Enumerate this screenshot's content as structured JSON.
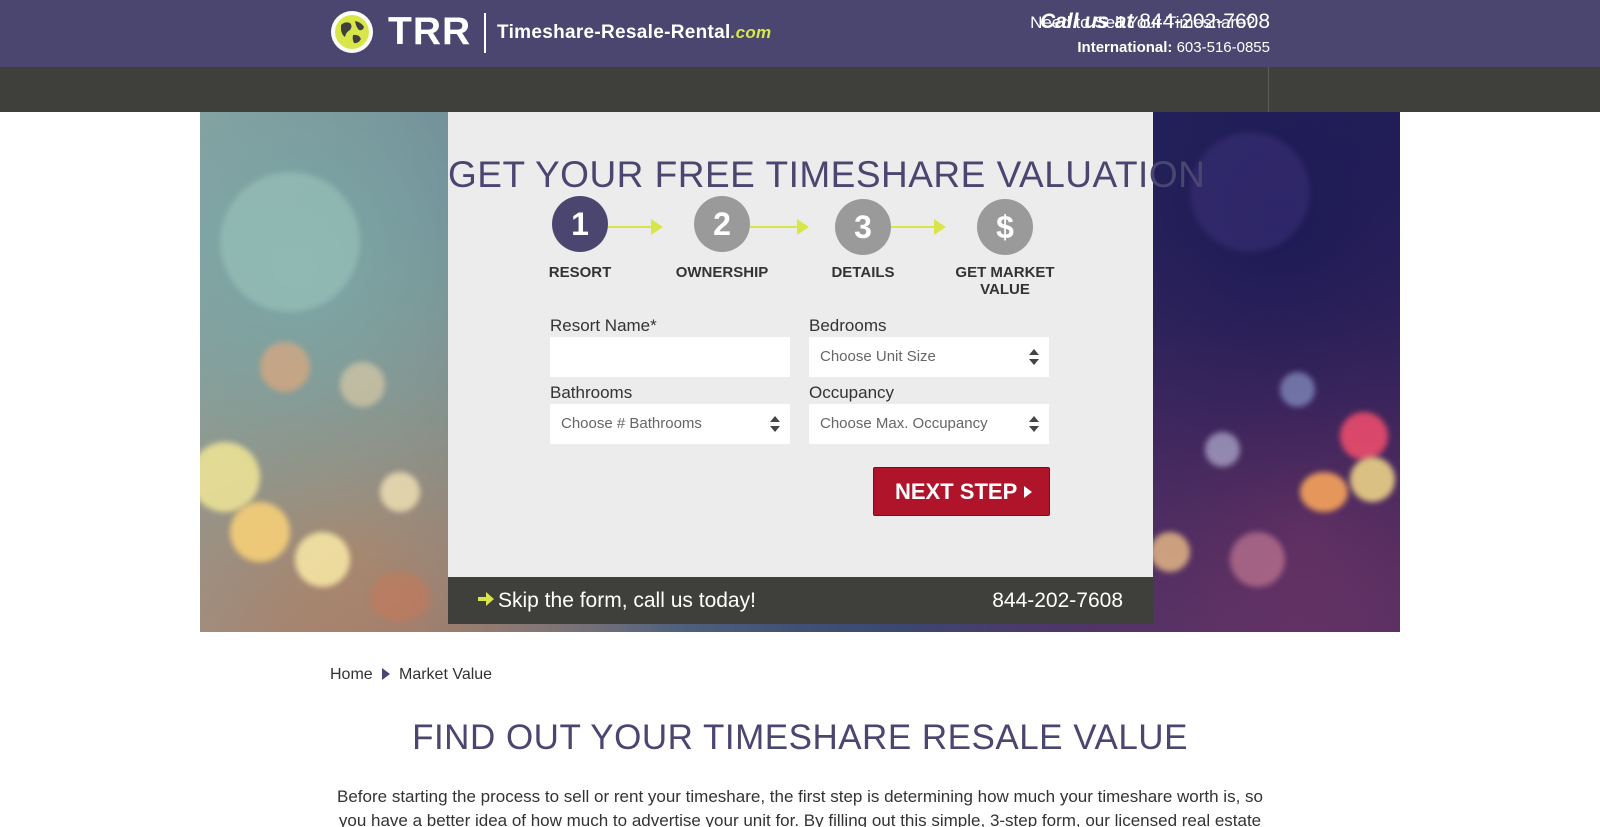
{
  "header": {
    "logo_text": "TRR",
    "domain_main": "Timeshare-Resale-Rental",
    "domain_suffix": ".com",
    "call_prefix": "Call us at",
    "call_phone": "844-202-7608",
    "intl_label": "International:",
    "intl_phone": "603-516-0855"
  },
  "nav": {
    "sell_link": "Need to Sell Your Timeshare?"
  },
  "form": {
    "title": "GET YOUR FREE TIMESHARE VALUATION",
    "steps": [
      {
        "number": "1",
        "label": "RESORT",
        "state": "active"
      },
      {
        "number": "2",
        "label": "OWNERSHIP",
        "state": "inactive"
      },
      {
        "number": "3",
        "label": "DETAILS",
        "state": "inactive"
      },
      {
        "number": "$",
        "label": "GET MARKET VALUE",
        "state": "inactive"
      }
    ],
    "fields": {
      "resort_name_label": "Resort Name*",
      "resort_name_value": "",
      "bedrooms_label": "Bedrooms",
      "bedrooms_value": "Choose Unit Size",
      "bathrooms_label": "Bathrooms",
      "bathrooms_value": "Choose # Bathrooms",
      "occupancy_label": "Occupancy",
      "occupancy_value": "Choose Max. Occupancy"
    },
    "next_button": "NEXT STEP",
    "skip_text": "Skip the form, call us today!",
    "skip_phone": "844-202-7608"
  },
  "breadcrumb": {
    "home": "Home",
    "current": "Market Value"
  },
  "content": {
    "heading": "FIND OUT YOUR TIMESHARE RESALE VALUE",
    "intro": "Before starting the process to sell or rent your timeshare, the first step is determining how much your timeshare worth is, so you have a better idea of how much to advertise your unit for. By filling out this simple, 3-step form, our licensed real estate"
  },
  "colors": {
    "brand_purple": "#4b4670",
    "accent_lime": "#d8e64a",
    "button_red": "#b0142b",
    "dark_bar": "#3f3f3b",
    "step_inactive": "#9a9a9a"
  },
  "icons": {
    "logo": "globe-icon",
    "select": "sort-arrows-icon",
    "skip": "arrow-right-icon",
    "button": "caret-right-icon",
    "breadcrumb": "caret-right-icon"
  }
}
